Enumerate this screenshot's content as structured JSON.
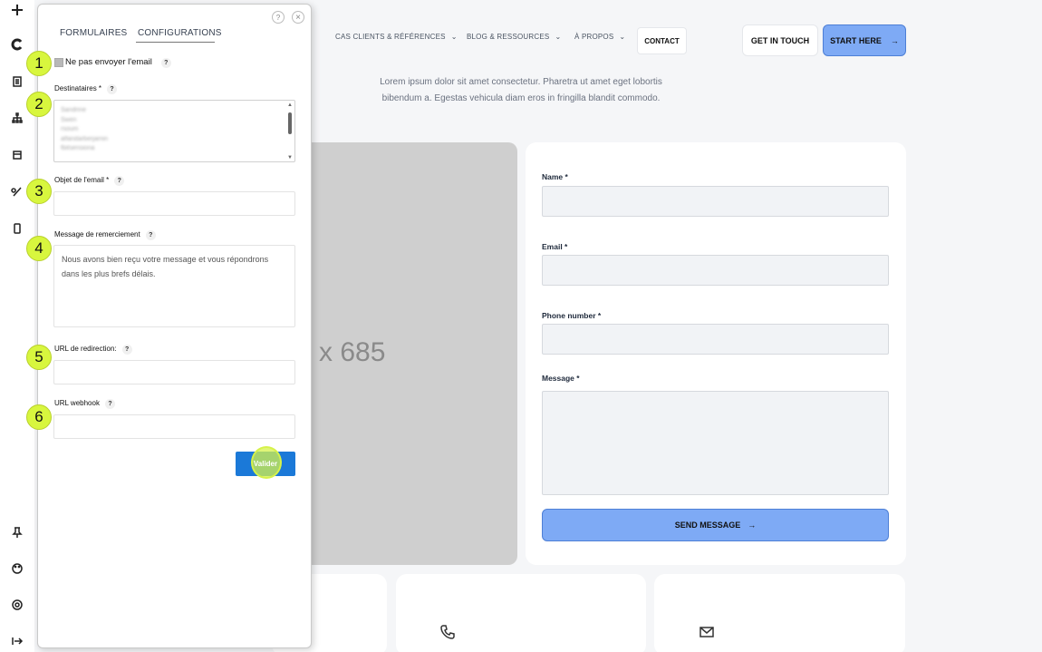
{
  "toolbar": {
    "icons": [
      "plus-icon",
      "c-logo-icon",
      "document-icon",
      "sitemap-icon",
      "layout-icon",
      "pen-tool-icon",
      "mobile-icon",
      "pin-icon",
      "palette-icon",
      "settings-icon",
      "exit-icon"
    ]
  },
  "site": {
    "nav": {
      "items": [
        {
          "label": "CAS CLIENTS & RÉFÉRENCES"
        },
        {
          "label": "BLOG & RESSOURCES"
        },
        {
          "label": "À PROPOS"
        }
      ],
      "contact": "CONTACT",
      "get_in_touch": "GET IN TOUCH",
      "start_here": "START HERE",
      "arrow": "→"
    },
    "intro_line1": "Lorem ipsum dolor sit amet consectetur. Pharetra ut amet eget lobortis",
    "intro_line2": "bibendum a. Egestas vehicula diam eros in fringilla blandit commodo.",
    "image_placeholder": "x 685",
    "form": {
      "name_label": "Name *",
      "email_label": "Email *",
      "phone_label": "Phone number *",
      "message_label": "Message *",
      "send_label": "SEND MESSAGE",
      "arrow": "→"
    }
  },
  "panel": {
    "tabs": [
      "FORMULAIRES",
      "CONFIGURATIONS"
    ],
    "help_symbol": "?",
    "close_symbol": "×",
    "no_email_label": "Ne pas envoyer l'email",
    "qmark": "?",
    "recipients_label": "Destinataires *",
    "recipients": [
      "Sandrine",
      "Swen",
      "rsoum",
      "alfandarberjamin",
      "fbitsensiona"
    ],
    "subject_label": "Objet de l'email *",
    "thanks_label": "Message de remerciement",
    "thanks_value": "Nous avons bien reçu votre message et vous répondrons dans les plus brefs délais.",
    "redirect_label": "URL de redirection:",
    "webhook_label": "URL webhook",
    "submit_label": "Valider"
  },
  "markers": [
    "1",
    "2",
    "3",
    "4",
    "5",
    "6"
  ],
  "colors": {
    "marker": "#d8f63e",
    "accent_blue": "#7eaaf5",
    "valider_blue": "#1b79d8"
  }
}
